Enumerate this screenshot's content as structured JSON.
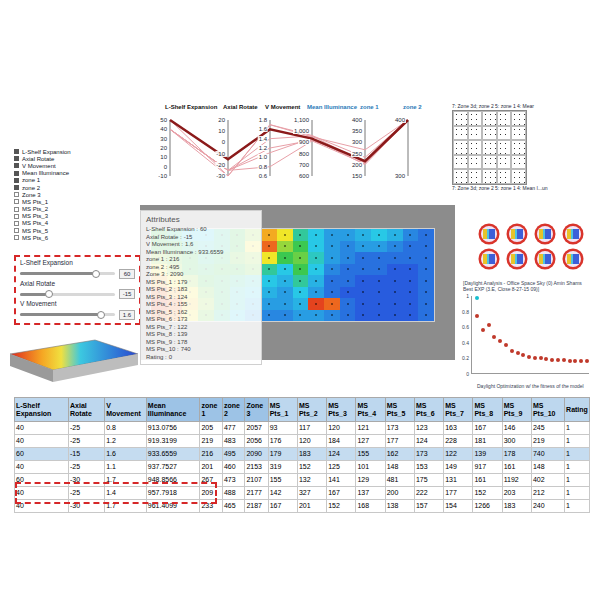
{
  "parallel_chart": {
    "axes": [
      {
        "title": "L-Shelf Expansion",
        "color": "#111111",
        "ticks": [
          "50",
          "40",
          "30",
          "20",
          "10",
          "0",
          "-10"
        ]
      },
      {
        "title": "Axial Rotate",
        "color": "#111111",
        "ticks": [
          "20",
          "10",
          "0",
          "-10",
          "-20",
          "-30"
        ]
      },
      {
        "title": "V Movement",
        "color": "#111111",
        "ticks": [
          "1.8",
          "1.6",
          "1.4",
          "1.2",
          "1.0",
          "0.8",
          "0.6"
        ]
      },
      {
        "title": "Mean Illuminance",
        "color": "#2a7ab8",
        "ticks": [
          "1,100",
          "1,000",
          "900",
          "800",
          "700",
          "600"
        ]
      },
      {
        "title": "zone 1",
        "color": "#2a7ab8",
        "ticks": [
          "400",
          "350",
          "300",
          "250",
          "200",
          "150"
        ]
      },
      {
        "title": "zone 2",
        "color": "#2a7ab8",
        "ticks": [
          "400",
          "300"
        ]
      }
    ],
    "lines": [
      {
        "values": [
          40,
          -25,
          0.8,
          913.0756,
          205,
          477
        ],
        "selected": false
      },
      {
        "values": [
          40,
          -25,
          1.2,
          919.3199,
          219,
          483
        ],
        "selected": false
      },
      {
        "values": [
          40,
          -25,
          1.1,
          937.7527,
          201,
          460
        ],
        "selected": false
      },
      {
        "values": [
          60,
          -30,
          1.7,
          948.8566,
          267,
          473
        ],
        "selected": false
      },
      {
        "values": [
          40,
          -25,
          1.4,
          957.7918,
          209,
          488
        ],
        "selected": false
      },
      {
        "values": [
          40,
          -30,
          1.7,
          961.4099,
          233,
          465
        ],
        "selected": false
      },
      {
        "values": [
          60,
          -15,
          1.6,
          933.6559,
          216,
          495
        ],
        "selected": true
      }
    ]
  },
  "matrix": {
    "caption_top": "7: Zone 3d; zone 2 5: zone 1 4: Mear",
    "caption_bottom": "7: Zone 3d; zone 2 5: zone 1 4: Mean I...un"
  },
  "checklist": [
    {
      "label": "L-Shelf Expansion",
      "checked": true
    },
    {
      "label": "Axial Rotate",
      "checked": true
    },
    {
      "label": "V Movement",
      "checked": true
    },
    {
      "label": "Mean Illuminance",
      "checked": true
    },
    {
      "label": "zone 1",
      "checked": true
    },
    {
      "label": "zone 2",
      "checked": true
    },
    {
      "label": "Zone 3",
      "checked": false
    },
    {
      "label": "MS Pts_1",
      "checked": false
    },
    {
      "label": "MS Pts_2",
      "checked": false
    },
    {
      "label": "MS Pts_3",
      "checked": false
    },
    {
      "label": "MS Pts_4",
      "checked": false
    },
    {
      "label": "MS Pts_5",
      "checked": false
    },
    {
      "label": "MS Pts_6",
      "checked": false
    }
  ],
  "sliders": [
    {
      "label": "L-Shelf Expansion",
      "value": "60",
      "level": 0.8
    },
    {
      "label": "Axial Rotate",
      "value": "-15",
      "level": 0.3
    },
    {
      "label": "V Movement",
      "value": "1.6",
      "level": 0.85
    }
  ],
  "viewer": {
    "attributes_title": "Attributes",
    "attributes": [
      {
        "label": "L-Shelf Expansion :",
        "value": "60"
      },
      {
        "label": "Axial Rotate :",
        "value": "-15"
      },
      {
        "label": "V Movement :",
        "value": "1.6"
      },
      {
        "label": "Mean Illuminance :",
        "value": "933.6559"
      },
      {
        "label": "zone 1 :",
        "value": "216"
      },
      {
        "label": "zone 2 :",
        "value": "495"
      },
      {
        "label": "Zone 3 :",
        "value": "2090"
      },
      {
        "label": "MS Pts_1 :",
        "value": "179"
      },
      {
        "label": "MS Pts_2 :",
        "value": "183"
      },
      {
        "label": "MS Pts_3 :",
        "value": "124"
      },
      {
        "label": "MS Pts_4 :",
        "value": "155"
      },
      {
        "label": "MS Pts_5 :",
        "value": "162"
      },
      {
        "label": "MS Pts_6 :",
        "value": "173"
      },
      {
        "label": "MS Pts_7 :",
        "value": "122"
      },
      {
        "label": "MS Pts_8 :",
        "value": "139"
      },
      {
        "label": "MS Pts_9 :",
        "value": "178"
      },
      {
        "label": "MS Pts_10 :",
        "value": "740"
      },
      {
        "label": "Rating :",
        "value": "0"
      }
    ],
    "heatmap": [
      [
        0.5,
        0.4,
        0.3,
        0.3,
        0.4,
        0.5,
        0.6,
        0.8,
        0.7,
        0.4,
        0.3,
        0.2,
        0.2,
        0.25,
        0.3,
        0.25,
        0.15,
        0.1
      ],
      [
        0.5,
        0.5,
        0.4,
        0.35,
        0.4,
        0.5,
        0.7,
        0.9,
        0.6,
        0.5,
        0.3,
        0.2,
        0.15,
        0.2,
        0.2,
        0.15,
        0.1,
        0.1
      ],
      [
        0.6,
        0.55,
        0.5,
        0.4,
        0.45,
        0.55,
        0.6,
        0.7,
        0.5,
        0.55,
        0.35,
        0.2,
        0.15,
        0.1,
        0.1,
        0.1,
        0.1,
        0.1
      ],
      [
        0.7,
        0.6,
        0.5,
        0.45,
        0.5,
        0.5,
        0.55,
        0.4,
        0.3,
        0.5,
        0.3,
        0.15,
        0.1,
        0.1,
        0.1,
        0.05,
        0.05,
        0.1
      ],
      [
        0.8,
        0.7,
        0.6,
        0.5,
        0.45,
        0.4,
        0.35,
        0.3,
        0.25,
        0.4,
        0.25,
        0.1,
        0.1,
        0.05,
        0.05,
        0.05,
        0.05,
        0.1
      ],
      [
        0.9,
        0.8,
        0.7,
        0.55,
        0.45,
        0.35,
        0.3,
        0.25,
        0.2,
        0.3,
        0.2,
        0.1,
        0.05,
        0.05,
        0.05,
        0.05,
        0.05,
        0.1
      ],
      [
        0.95,
        0.9,
        0.75,
        0.6,
        0.45,
        0.35,
        0.25,
        0.2,
        0.2,
        0.25,
        0.95,
        0.9,
        0.1,
        0.05,
        0.05,
        0.05,
        0.05,
        0.1
      ],
      [
        0.9,
        0.85,
        0.7,
        0.55,
        0.4,
        0.3,
        0.2,
        0.15,
        0.15,
        0.2,
        0.2,
        0.15,
        0.1,
        0.05,
        0.05,
        0.05,
        0.05,
        0.1
      ]
    ]
  },
  "fitness_chart": {
    "title": "[Daylight Analysis - Office Space Sky (0) Amin Shams Best EXP (3.E, Close 8-27-15 09)]",
    "y_ticks": [
      "1",
      "0.8",
      "0.6",
      "0.4",
      "0.2",
      "0"
    ],
    "legend": "Daylight Optimization w/ the fitness of the model",
    "series": [
      {
        "color": "#c0392b",
        "values": [
          0.74,
          0.56,
          0.63,
          0.47,
          0.42,
          0.37,
          0.3,
          0.27,
          0.24,
          0.22,
          0.21,
          0.2,
          0.19,
          0.185,
          0.18,
          0.175,
          0.17,
          0.168,
          0.165,
          0.163
        ]
      },
      {
        "color": "#17becf",
        "values": [
          0.97
        ]
      }
    ]
  },
  "table": {
    "columns": [
      {
        "label": "L-Shelf Expansion",
        "color": "#bdd7ee"
      },
      {
        "label": "Axial Rotate",
        "color": "#bdd7ee"
      },
      {
        "label": "V  Movement",
        "color": "#bdd7ee"
      },
      {
        "label": "Mean Illuminance",
        "color": "#9dc3e6"
      },
      {
        "label": "zone 1",
        "color": "#9dc3e6"
      },
      {
        "label": "zone 2",
        "color": "#9dc3e6"
      },
      {
        "label": "Zone 3",
        "color": "#9dc3e6"
      },
      {
        "label": "MS Pts_1",
        "color": "#bdd7ee"
      },
      {
        "label": "MS Pts_2",
        "color": "#bdd7ee"
      },
      {
        "label": "MS Pts_3",
        "color": "#bdd7ee"
      },
      {
        "label": "MS Pts_4",
        "color": "#bdd7ee"
      },
      {
        "label": "MS Pts_5",
        "color": "#bdd7ee"
      },
      {
        "label": "MS Pts_6",
        "color": "#bdd7ee"
      },
      {
        "label": "MS Pts_7",
        "color": "#bdd7ee"
      },
      {
        "label": "MS Pts_8",
        "color": "#bdd7ee"
      },
      {
        "label": "MS Pts_9",
        "color": "#bdd7ee"
      },
      {
        "label": "MS Pts_10",
        "color": "#bdd7ee"
      },
      {
        "label": "Rating",
        "color": "#bdd7ee"
      }
    ],
    "rows": [
      {
        "selected": false,
        "cells": [
          "40",
          "-25",
          "0.8",
          "913.0756",
          "205",
          "477",
          "2057",
          "93",
          "117",
          "120",
          "121",
          "173",
          "123",
          "163",
          "167",
          "146",
          "245",
          "1"
        ]
      },
      {
        "selected": false,
        "cells": [
          "40",
          "-25",
          "1.2",
          "919.3199",
          "219",
          "483",
          "2056",
          "176",
          "120",
          "184",
          "127",
          "177",
          "124",
          "228",
          "181",
          "300",
          "219",
          "1"
        ]
      },
      {
        "selected": true,
        "cells": [
          "60",
          "-15",
          "1.6",
          "933.6559",
          "216",
          "495",
          "2090",
          "179",
          "183",
          "124",
          "155",
          "162",
          "173",
          "122",
          "139",
          "178",
          "740",
          "1"
        ]
      },
      {
        "selected": false,
        "cells": [
          "40",
          "-25",
          "1.1",
          "937.7527",
          "201",
          "460",
          "2153",
          "319",
          "152",
          "125",
          "101",
          "148",
          "153",
          "149",
          "917",
          "161",
          "148",
          "1"
        ]
      },
      {
        "selected": false,
        "cells": [
          "60",
          "-30",
          "1.7",
          "948.8566",
          "267",
          "473",
          "2107",
          "155",
          "132",
          "141",
          "129",
          "481",
          "175",
          "131",
          "161",
          "1192",
          "402",
          "1"
        ]
      },
      {
        "selected": false,
        "cells": [
          "40",
          "-25",
          "1.4",
          "957.7918",
          "209",
          "488",
          "2177",
          "142",
          "327",
          "167",
          "137",
          "200",
          "222",
          "177",
          "152",
          "203",
          "212",
          "1"
        ]
      },
      {
        "selected": false,
        "cells": [
          "40",
          "-30",
          "1.7",
          "961.4099",
          "233",
          "465",
          "2187",
          "167",
          "201",
          "152",
          "168",
          "138",
          "157",
          "154",
          "1266",
          "183",
          "240",
          "1"
        ]
      }
    ]
  }
}
